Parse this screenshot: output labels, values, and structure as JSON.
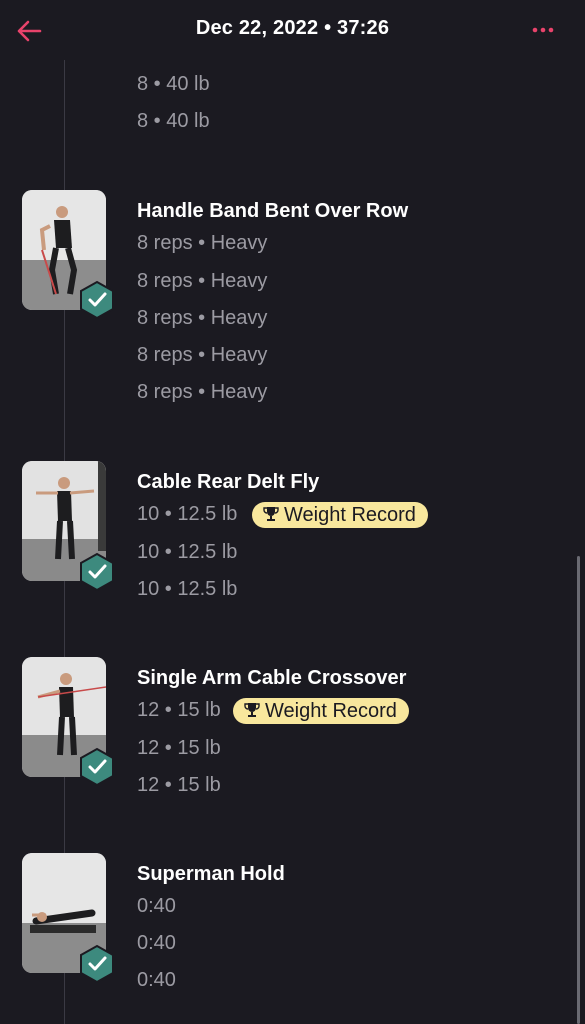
{
  "header": {
    "title": "Dec 22, 2022 • 37:26",
    "accent_color": "#e8436b",
    "back_icon": "arrow-left-icon",
    "more_icon": "more-dots-icon"
  },
  "top_sets": [
    "8 • 40 lb",
    "8 • 40 lb"
  ],
  "exercises": [
    {
      "name": "Handle Band Bent Over Row",
      "sets": [
        "8 reps • Heavy",
        "8 reps • Heavy",
        "8 reps • Heavy",
        "8 reps • Heavy",
        "8 reps • Heavy"
      ]
    },
    {
      "name": "Cable Rear Delt Fly",
      "sets": [
        "10 • 12.5 lb",
        "10 • 12.5 lb",
        "10 • 12.5 lb"
      ],
      "badge": "Weight Record"
    },
    {
      "name": "Single Arm Cable Crossover",
      "sets": [
        "12 • 15 lb",
        "12 • 15 lb",
        "12 • 15 lb"
      ],
      "badge": "Weight Record"
    },
    {
      "name": "Superman Hold",
      "sets": [
        "0:40",
        "0:40",
        "0:40"
      ]
    }
  ],
  "badge_color": "#f8e79d",
  "check_color": "#3d8a7e"
}
